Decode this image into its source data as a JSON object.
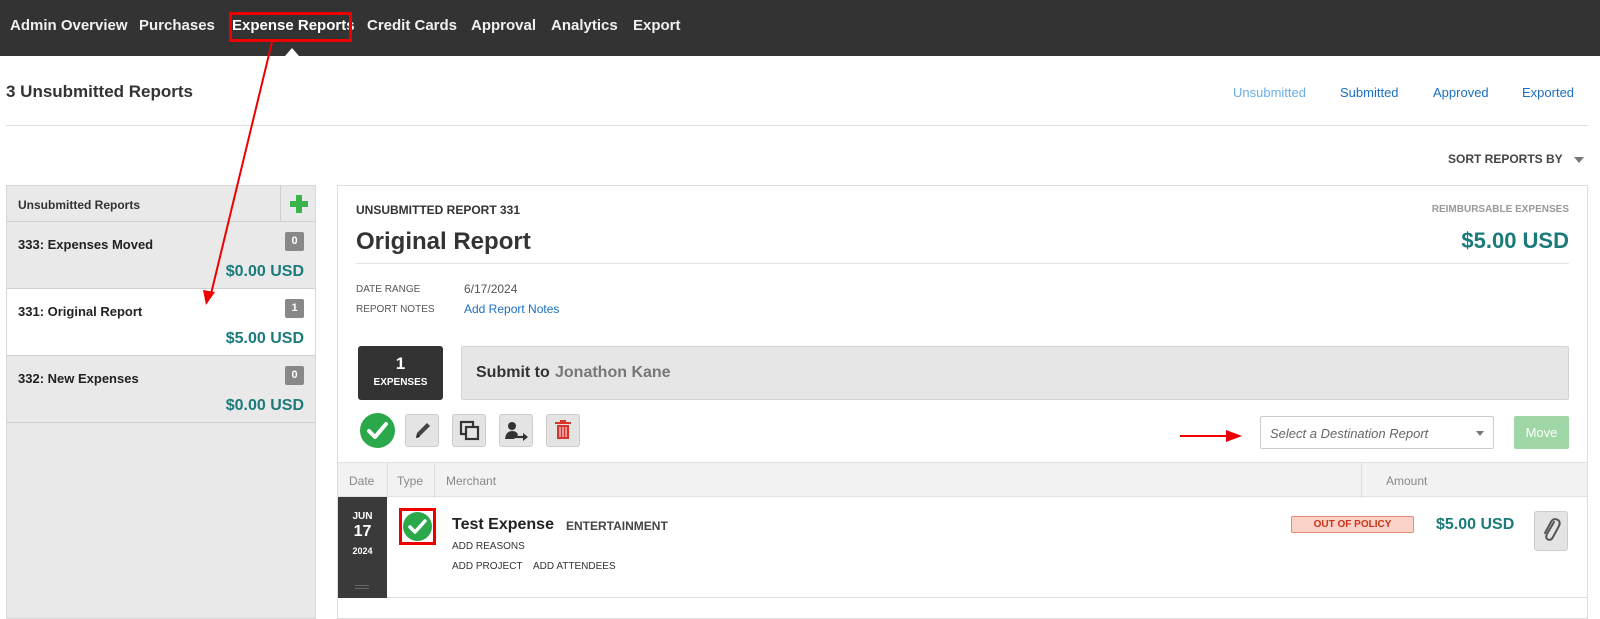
{
  "topnav": {
    "items": [
      "Admin Overview",
      "Purchases",
      "Expense Reports",
      "Credit Cards",
      "Approval",
      "Analytics",
      "Export"
    ],
    "active": "Expense Reports"
  },
  "page": {
    "title": "3 Unsubmitted Reports",
    "filters": [
      "Unsubmitted",
      "Submitted",
      "Approved",
      "Exported"
    ],
    "active_filter": "Unsubmitted",
    "sort_label": "SORT REPORTS BY"
  },
  "sidebar": {
    "header": "Unsubmitted Reports",
    "reports": [
      {
        "name": "333: Expenses Moved",
        "count": "0",
        "amount": "$0.00 USD"
      },
      {
        "name": "331: Original Report",
        "count": "1",
        "amount": "$5.00 USD"
      },
      {
        "name": "332: New Expenses",
        "count": "0",
        "amount": "$0.00 USD"
      }
    ],
    "selected": "331: Original Report"
  },
  "report": {
    "label": "UNSUBMITTED REPORT 331",
    "reimbursable_label": "REIMBURSABLE EXPENSES",
    "name": "Original Report",
    "total": "$5.00 USD",
    "date_range_label": "DATE RANGE",
    "date_range": "6/17/2024",
    "notes_label": "REPORT NOTES",
    "notes_link": "Add Report Notes",
    "expense_count": "1",
    "expense_count_label": "EXPENSES",
    "submit_to_label": "Submit to",
    "approver": "Jonathon Kane",
    "destination_placeholder": "Select a Destination Report",
    "move_label": "Move"
  },
  "table": {
    "headers": [
      "Date",
      "Type",
      "Merchant",
      "Amount"
    ]
  },
  "expenses": [
    {
      "month": "JUN",
      "day": "17",
      "year": "2024",
      "merchant": "Test Expense",
      "category": "ENTERTAINMENT",
      "add_reasons": "ADD REASONS",
      "add_project": "ADD PROJECT",
      "add_attendees": "ADD ATTENDEES",
      "policy_badge": "OUT OF POLICY",
      "amount": "$5.00 USD"
    }
  ],
  "colors": {
    "nav_bg": "#333333",
    "accent_teal": "#1b7a7a",
    "link_blue": "#1a6fc2",
    "approve_green": "#2aa84a",
    "annotation_red": "#ee0000"
  },
  "icons": [
    "plus-icon",
    "check-icon",
    "pencil-icon",
    "copy-icon",
    "reassign-icon",
    "trash-icon",
    "paperclip-icon",
    "chevron-down-icon"
  ]
}
